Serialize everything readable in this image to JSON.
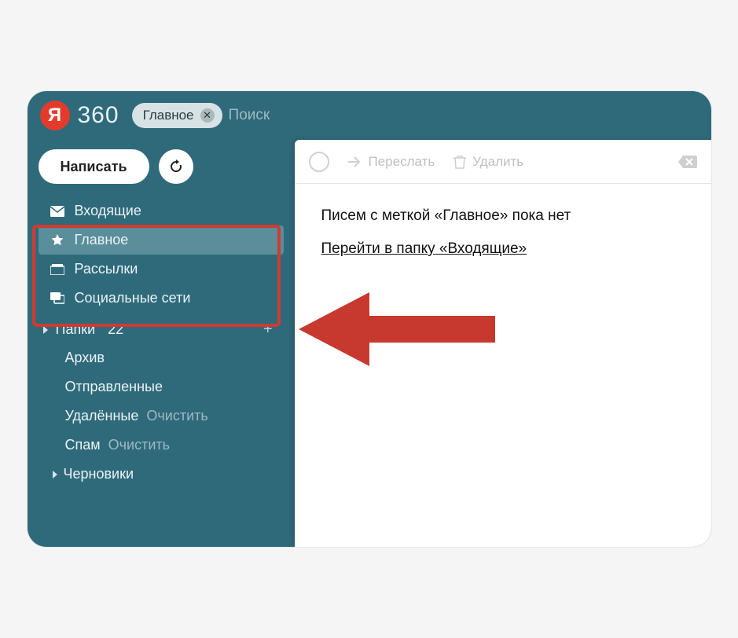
{
  "logo": {
    "letter": "Я",
    "text": "360"
  },
  "search": {
    "chip_label": "Главное",
    "placeholder": "Поиск"
  },
  "sidebar": {
    "compose": "Написать",
    "categories": [
      {
        "id": "inbox",
        "label": "Входящие",
        "icon": "mail"
      },
      {
        "id": "important",
        "label": "Главное",
        "icon": "star",
        "active": true
      },
      {
        "id": "newsletters",
        "label": "Рассылки",
        "icon": "tray"
      },
      {
        "id": "social",
        "label": "Социальные сети",
        "icon": "chat"
      }
    ],
    "folders_title": "Папки",
    "folders_count": "22",
    "folders": [
      {
        "label": "Архив"
      },
      {
        "label": "Отправленные"
      },
      {
        "label": "Удалённые",
        "action": "Очистить"
      },
      {
        "label": "Спам",
        "action": "Очистить"
      },
      {
        "label": "Черновики",
        "caret": true
      }
    ]
  },
  "toolbar": {
    "forward": "Переслать",
    "delete": "Удалить"
  },
  "content": {
    "empty_msg": "Писем с меткой «Главное» пока нет",
    "link": "Перейти в папку «Входящие»"
  },
  "annotation": {
    "arrow_color": "#c7392e",
    "highlight_color": "#d23a30"
  }
}
